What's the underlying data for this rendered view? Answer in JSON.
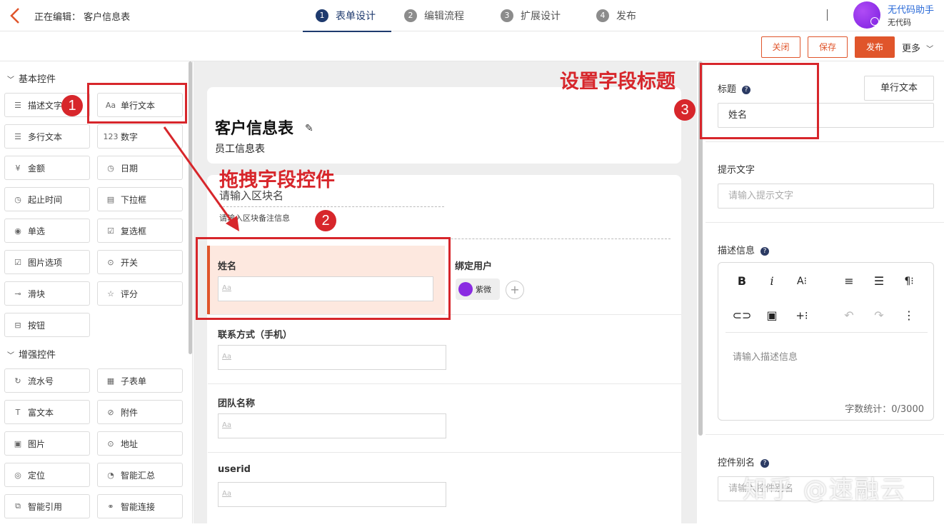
{
  "topbar": {
    "editing_label": "正在编辑：  客户信息表",
    "steps": [
      {
        "num": "1",
        "label": "表单设计",
        "active": true
      },
      {
        "num": "2",
        "label": "编辑流程"
      },
      {
        "num": "3",
        "label": "扩展设计"
      },
      {
        "num": "4",
        "label": "发布"
      }
    ],
    "user": {
      "name": "无代码助手",
      "sub": "无代码"
    }
  },
  "actions": {
    "close": "关闭",
    "save": "保存",
    "publish": "发布",
    "more": "更多"
  },
  "left": {
    "basic_title": "基本控件",
    "basic": [
      {
        "label": "描述文字",
        "icon": "doc-icon"
      },
      {
        "label": "单行文本",
        "icon": "aa-icon"
      },
      {
        "label": "多行文本",
        "icon": "lines-icon"
      },
      {
        "label": "数字",
        "icon": "number-icon"
      },
      {
        "label": "金额",
        "icon": "yen-icon"
      },
      {
        "label": "日期",
        "icon": "clock-icon"
      },
      {
        "label": "起止时间",
        "icon": "clock-icon"
      },
      {
        "label": "下拉框",
        "icon": "dropdown-icon"
      },
      {
        "label": "单选",
        "icon": "radio-icon"
      },
      {
        "label": "复选框",
        "icon": "checkbox-icon"
      },
      {
        "label": "图片选项",
        "icon": "image-check-icon"
      },
      {
        "label": "开关",
        "icon": "toggle-icon"
      },
      {
        "label": "滑块",
        "icon": "slider-icon"
      },
      {
        "label": "评分",
        "icon": "star-icon"
      },
      {
        "label": "按钮",
        "icon": "button-icon"
      }
    ],
    "enhanced_title": "增强控件",
    "enhanced": [
      {
        "label": "流水号",
        "icon": "serial-icon"
      },
      {
        "label": "子表单",
        "icon": "table-icon"
      },
      {
        "label": "富文本",
        "icon": "richtext-icon"
      },
      {
        "label": "附件",
        "icon": "attachment-icon"
      },
      {
        "label": "图片",
        "icon": "image-icon"
      },
      {
        "label": "地址",
        "icon": "location-icon"
      },
      {
        "label": "定位",
        "icon": "pin-icon"
      },
      {
        "label": "智能汇总",
        "icon": "pie-icon"
      },
      {
        "label": "智能引用",
        "icon": "ref-icon"
      },
      {
        "label": "智能连接",
        "icon": "link-nodes-icon"
      }
    ]
  },
  "canvas": {
    "form_title": "客户信息表",
    "form_subtitle": "员工信息表",
    "block_name_ph": "请输入区块名",
    "block_note_ph": "请输入区块备注信息",
    "field_aa": "Aa",
    "fields": {
      "name": "姓名",
      "bind_user": "绑定用户",
      "bound_user": "紫微",
      "phone": "联系方式（手机）",
      "team": "团队名称",
      "userid": "userid"
    }
  },
  "right": {
    "title_label": "标题",
    "type_label": "单行文本",
    "title_value": "姓名",
    "hint_label": "提示文字",
    "hint_ph": "请输入提示文字",
    "desc_label": "描述信息",
    "desc_ph": "请输入描述信息",
    "count": "字数统计：0/3000",
    "alias_label": "控件别名",
    "alias_ph": "请输入控件别名"
  },
  "annotations": {
    "drag": "拖拽字段控件",
    "set_title": "设置字段标题",
    "n1": "1",
    "n2": "2",
    "n3": "3",
    "watermark": "知乎 @速融云"
  },
  "colors": {
    "accent": "#e0552b",
    "annotation": "#d7262b",
    "active_step": "#1e3a6e"
  }
}
